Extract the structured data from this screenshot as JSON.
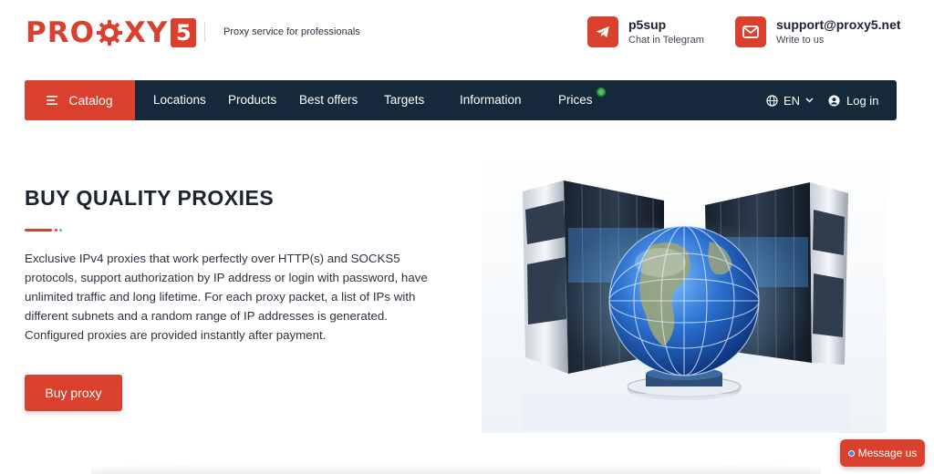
{
  "header": {
    "logo_text": "PRO",
    "logo_text_end": "Y",
    "logo_x": "X",
    "logo_badge": "5",
    "tagline": "Proxy service for professionals",
    "telegram": {
      "title": "p5sup",
      "subtitle": "Chat in Telegram",
      "icon": "telegram-icon"
    },
    "email": {
      "title": "support@proxy5.net",
      "subtitle": "Write to us",
      "icon": "mail-icon"
    }
  },
  "nav": {
    "catalog_label": "Catalog",
    "items": [
      "Locations",
      "Products",
      "Best offers",
      "Targets",
      "Information",
      "Prices"
    ],
    "language": "EN",
    "login_label": "Log in"
  },
  "hero": {
    "title": "BUY QUALITY PROXIES",
    "description": "Exclusive IPv4 proxies that work perfectly over HTTP(s) and SOCKS5 protocols, support authorization by IP address or login with password, have unlimited traffic and long lifetime. For each proxy packet, a list of IPs with different subnets and a random range of IP addresses is generated. Configured proxies are provided instantly after payment.",
    "cta_label": "Buy proxy"
  },
  "chat": {
    "label": "Message us"
  },
  "colors": {
    "accent": "#d9412e",
    "nav_bg": "#15293b",
    "status_green": "#4cc860"
  }
}
